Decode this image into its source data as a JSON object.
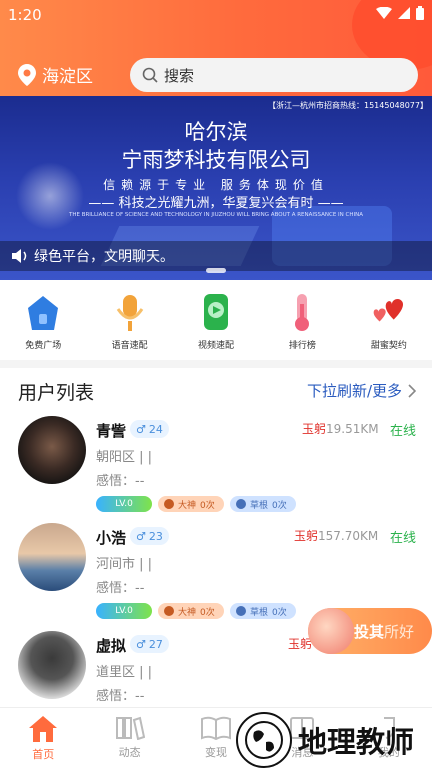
{
  "status_bar": {
    "time": "1:20"
  },
  "header": {
    "location": "海淀区",
    "search_placeholder": "搜索"
  },
  "banner": {
    "hotline": "【浙江—杭州市招商热线：15145048077】",
    "city": "哈尔滨",
    "company": "宁雨梦科技有限公司",
    "slogan": "信赖源于专业  服务体现价值",
    "tagline_cn": "—— 科技之光耀九洲，华夏复兴会有时 ——",
    "tagline_en": "THE BRILLIANCE OF SCIENCE AND TECHNOLOGY IN JIUZHOU WILL BRING ABOUT A RENAISSANCE IN CHINA",
    "marquee": "绿色平台，文明聊天。"
  },
  "menu": [
    {
      "label": "免费广场",
      "icon": "house-icon",
      "color": "#2f7de1"
    },
    {
      "label": "语音速配",
      "icon": "microphone-icon",
      "color": "#f2a33a"
    },
    {
      "label": "视频速配",
      "icon": "video-chat-icon",
      "color": "#2bb24c"
    },
    {
      "label": "排行榜",
      "icon": "thermometer-icon",
      "color": "#f0607a"
    },
    {
      "label": "甜蜜契约",
      "icon": "hearts-icon",
      "color": "#e0302a"
    }
  ],
  "list": {
    "title": "用户列表",
    "more": "下拉刷新/更多"
  },
  "users": [
    {
      "name": "青訾",
      "age": "24",
      "brand": "玉躬",
      "distance": "19.51KM",
      "online": "在线",
      "area": "朝阳区 | |",
      "insight": "感悟：--",
      "level": "LV.0",
      "god": "大神",
      "god_count": "0次",
      "grass": "草根",
      "grass_count": "0次"
    },
    {
      "name": "小浩",
      "age": "23",
      "brand": "玉躬",
      "distance": "157.70KM",
      "online": "在线",
      "area": "河间市 | |",
      "insight": "感悟：--",
      "level": "LV.0",
      "god": "大神",
      "god_count": "0次",
      "grass": "草根",
      "grass_count": "0次"
    },
    {
      "name": "虚拟",
      "age": "27",
      "brand": "玉躬",
      "distance": "",
      "online": "",
      "area": "道里区 | |",
      "insight": "感悟：--"
    }
  ],
  "promo": {
    "text": "投其",
    "sub": "所好"
  },
  "bottom_nav": [
    {
      "label": "首页",
      "icon": "home-icon",
      "active": true
    },
    {
      "label": "动态",
      "icon": "books-icon",
      "active": false
    },
    {
      "label": "变现",
      "icon": "open-book-icon",
      "active": false
    },
    {
      "label": "消息",
      "icon": "message-icon",
      "active": false
    },
    {
      "label": "我的",
      "icon": "profile-icon",
      "active": false
    }
  ],
  "watermark": {
    "text": "地理教师"
  },
  "colors": {
    "accent": "#ff6b3d",
    "brand_red": "#e0302a",
    "online_green": "#2bb24c",
    "link_blue": "#2a5bbf"
  }
}
